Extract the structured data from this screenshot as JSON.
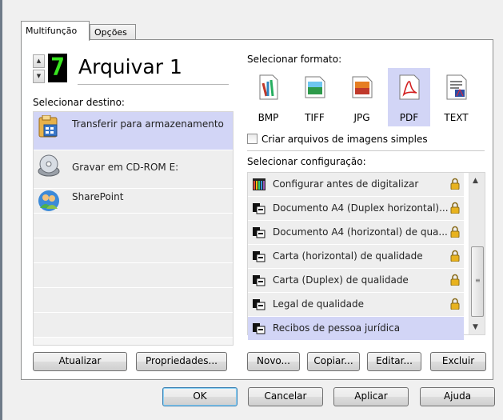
{
  "tabs": [
    "Multifunção",
    "Opções"
  ],
  "profile": {
    "number": "7",
    "name": "Arquivar 1"
  },
  "destination": {
    "label": "Selecionar destino:",
    "items": [
      {
        "label": "Transferir para armazenamento",
        "icon": "file-cabinet-icon",
        "selected": true
      },
      {
        "label": "Gravar em CD-ROM  E:",
        "icon": "cd-rom-icon",
        "selected": false
      },
      {
        "label": "SharePoint",
        "icon": "sharepoint-people-icon",
        "selected": false
      }
    ],
    "buttons": {
      "refresh": "Atualizar",
      "properties": "Propriedades..."
    }
  },
  "format": {
    "label": "Selecionar formato:",
    "items": [
      {
        "label": "BMP",
        "icon": "bmp-format-icon",
        "selected": false
      },
      {
        "label": "TIFF",
        "icon": "tiff-format-icon",
        "selected": false
      },
      {
        "label": "JPG",
        "icon": "jpg-format-icon",
        "selected": false
      },
      {
        "label": "PDF",
        "icon": "pdf-format-icon",
        "selected": true
      },
      {
        "label": "TEXT",
        "icon": "text-format-icon",
        "selected": false
      }
    ],
    "single_image_checkbox": {
      "label": "Criar arquivos de imagens simples",
      "checked": false
    }
  },
  "configuration": {
    "label": "Selecionar configuração:",
    "items": [
      {
        "label": "Configurar antes de digitalizar",
        "icon": "color-bars-icon",
        "locked": true,
        "selected": false
      },
      {
        "label": "Documento A4 (Duplex horizontal)...",
        "icon": "scanner-icon",
        "locked": true,
        "selected": false
      },
      {
        "label": "Documento A4 (horizontal) de qua...",
        "icon": "scanner-icon",
        "locked": true,
        "selected": false
      },
      {
        "label": "Carta (horizontal) de qualidade",
        "icon": "scanner-icon",
        "locked": true,
        "selected": false
      },
      {
        "label": "Carta (Duplex) de qualidade",
        "icon": "scanner-icon",
        "locked": true,
        "selected": false
      },
      {
        "label": "Legal de qualidade",
        "icon": "scanner-icon",
        "locked": true,
        "selected": false
      },
      {
        "label": "Recibos de pessoa jurídica",
        "icon": "scanner-icon",
        "locked": false,
        "selected": true
      }
    ],
    "buttons": {
      "new": "Novo...",
      "copy": "Copiar...",
      "edit": "Editar...",
      "delete": "Excluir"
    }
  },
  "footer": {
    "ok": "OK",
    "cancel": "Cancelar",
    "apply": "Aplicar",
    "help": "Ajuda"
  },
  "colors": {
    "selection": "#d2d5f6",
    "lcd_digit": "#38e51f",
    "lock": "#e8b21e"
  }
}
